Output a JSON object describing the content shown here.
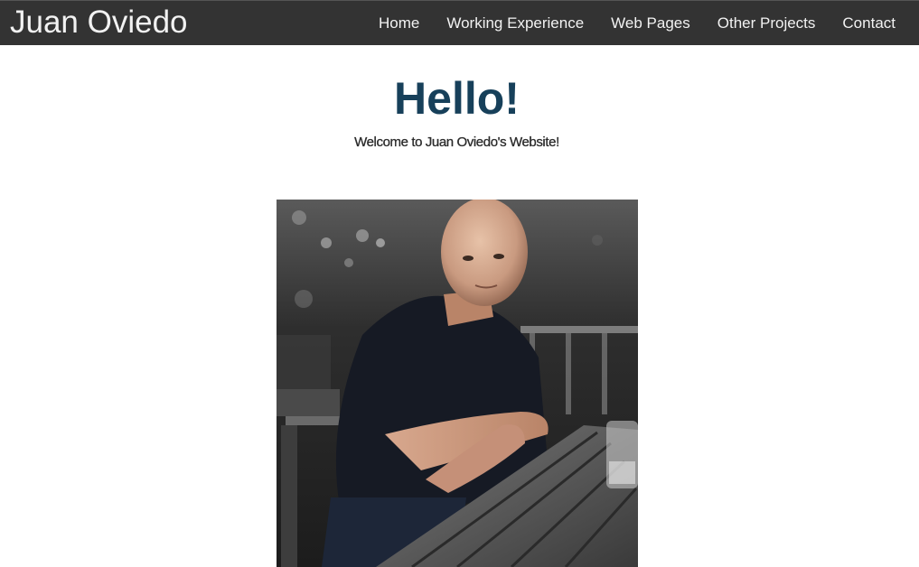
{
  "navbar": {
    "brand": "Juan Oviedo",
    "links": [
      {
        "label": "Home"
      },
      {
        "label": "Working Experience"
      },
      {
        "label": "Web Pages"
      },
      {
        "label": "Other Projects"
      },
      {
        "label": "Contact"
      }
    ]
  },
  "hero": {
    "title": "Hello!",
    "subtitle": "Welcome to Juan Oviedo's Website!"
  },
  "colors": {
    "navbar_bg": "#333333",
    "nav_text": "#f2f2f2",
    "title": "#17405a"
  }
}
